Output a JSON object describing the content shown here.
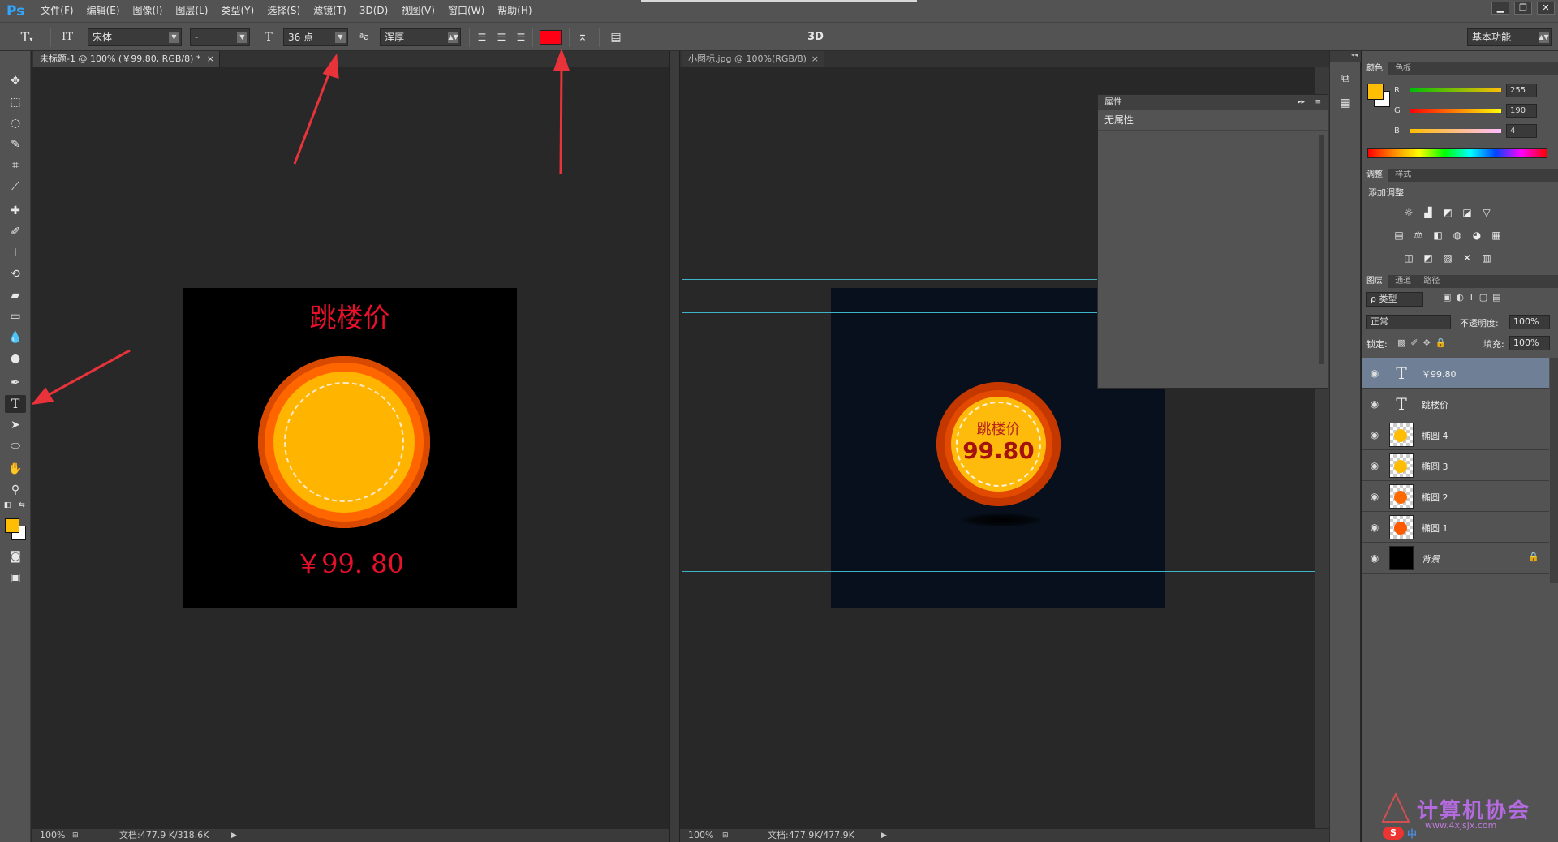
{
  "app": {
    "logo": "Ps",
    "menu": [
      "文件(F)",
      "编辑(E)",
      "图像(I)",
      "图层(L)",
      "类型(Y)",
      "选择(S)",
      "滤镜(T)",
      "3D(D)",
      "视图(V)",
      "窗口(W)",
      "帮助(H)"
    ],
    "window_controls": [
      "▁",
      "❐",
      "✕"
    ]
  },
  "options_bar": {
    "font_family": "宋体",
    "font_style": "-",
    "font_size": "36 点",
    "aa_label": "ªa",
    "antialias": "浑厚",
    "text_color": "#ff0015",
    "three_d": "3D",
    "workspace": "基本功能"
  },
  "colors": {
    "foreground": "#ffbe04",
    "background": "#ffffff",
    "accent_red": "#e8102a",
    "guide": "#3fb4c9"
  },
  "doc1": {
    "tab": "未标题-1 @ 100% (￥99.80, RGB/8) *",
    "canvas_title": "跳楼价",
    "canvas_price": "￥99. 80",
    "zoom": "100%",
    "docsize": "文档:477.9 K/318.6K"
  },
  "doc2": {
    "tab": "小图标.jpg @ 100%(RGB/8)",
    "badge_title": "跳楼价",
    "badge_price": "99.80",
    "zoom": "100%",
    "docsize": "文档:477.9K/477.9K"
  },
  "properties_panel": {
    "title": "属性",
    "content": "无属性"
  },
  "color_panel": {
    "tabs": [
      "颜色",
      "色板"
    ],
    "r_label": "R",
    "r": "255",
    "g_label": "G",
    "g": "190",
    "b_label": "B",
    "b": "4"
  },
  "adjust_panel": {
    "tabs": [
      "调整",
      "样式"
    ],
    "heading": "添加调整",
    "icons": [
      "brightness-icon",
      "levels-icon",
      "curves-icon",
      "exposure-icon",
      "vibrance-icon",
      "hue-icon",
      "color-balance-icon",
      "bw-icon",
      "photo-filter-icon",
      "channel-mixer-icon",
      "color-lookup-icon",
      "invert-icon",
      "posterize-icon",
      "threshold-icon",
      "selective-color-icon",
      "gradient-map-icon"
    ]
  },
  "layers_panel": {
    "tabs": [
      "图层",
      "通道",
      "路径"
    ],
    "filter": "ρ 类型",
    "blend_mode": "正常",
    "opacity_label": "不透明度:",
    "opacity": "100%",
    "lock_label": "锁定:",
    "fill_label": "填充:",
    "fill": "100%",
    "layers": [
      {
        "name": "￥99.80",
        "kind": "text"
      },
      {
        "name": "跳楼价",
        "kind": "text"
      },
      {
        "name": "椭圆 4",
        "kind": "shape",
        "dot": "#ffbe04"
      },
      {
        "name": "椭圆 3",
        "kind": "shape",
        "dot": "#ffbe04"
      },
      {
        "name": "椭圆 2",
        "kind": "shape",
        "dot": "#ff6a00"
      },
      {
        "name": "椭圆 1",
        "kind": "shape",
        "dot": "#ff5a00"
      },
      {
        "name": "背景",
        "kind": "background"
      }
    ]
  },
  "watermark": {
    "text": "计算机协会",
    "url": "www.4xjsjx.com",
    "tray": "中"
  }
}
